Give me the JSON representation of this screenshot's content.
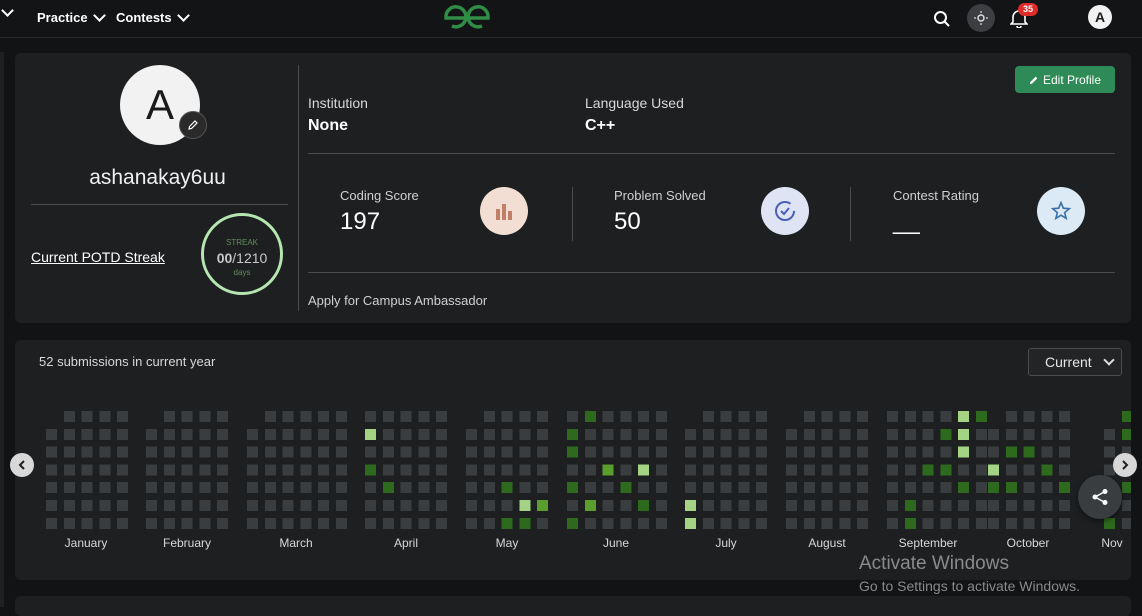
{
  "nav": {
    "practice_label": "Practice",
    "contests_label": "Contests",
    "notification_count": "35",
    "avatar_letter": "A"
  },
  "profile": {
    "avatar_letter": "A",
    "username": "ashanakay6uu",
    "potd_label": "Current POTD Streak",
    "streak": {
      "label": "STREAK",
      "current": "00",
      "separator": "/",
      "total": "1210",
      "unit": "days"
    },
    "institution_label": "Institution",
    "institution_value": "None",
    "language_label": "Language Used",
    "language_value": "C++",
    "edit_label": "Edit Profile",
    "stats": [
      {
        "label": "Coding Score",
        "value": "197"
      },
      {
        "label": "Problem Solved",
        "value": "50"
      },
      {
        "label": "Contest Rating",
        "value": "__"
      }
    ],
    "ambassador_label": "Apply for Campus Ambassador"
  },
  "heatmap": {
    "submissions_text": "52 submissions in current year",
    "select_value": "Current",
    "months": [
      "January",
      "February",
      "March",
      "April",
      "May",
      "June",
      "July",
      "August",
      "September",
      "October",
      "Nov"
    ],
    "colors": {
      "empty": "#3a3d40",
      "level1": "#2d6a1e",
      "level2": "#5a9e2e",
      "level3": "#a4d483"
    }
  },
  "watermark": {
    "title": "Activate Windows",
    "subtitle": "Go to Settings to activate Windows."
  }
}
